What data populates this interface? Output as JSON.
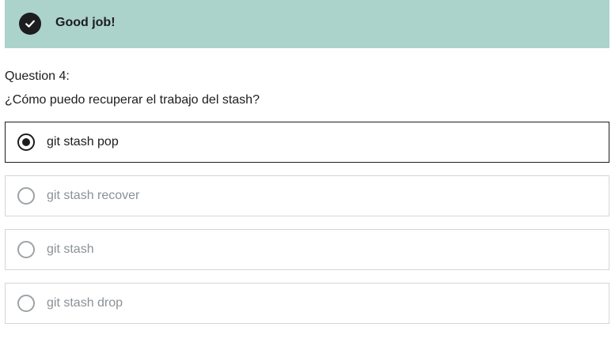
{
  "feedback": {
    "icon": "check-circle-icon",
    "title": "Good job!",
    "background_color": "#acd2cc"
  },
  "question": {
    "number_label": "Question 4:",
    "text": "¿Cómo puedo recuperar el trabajo del stash?"
  },
  "options": [
    {
      "label": "git stash pop",
      "selected": true
    },
    {
      "label": "git stash recover",
      "selected": false
    },
    {
      "label": "git stash",
      "selected": false
    },
    {
      "label": "git stash drop",
      "selected": false
    }
  ]
}
